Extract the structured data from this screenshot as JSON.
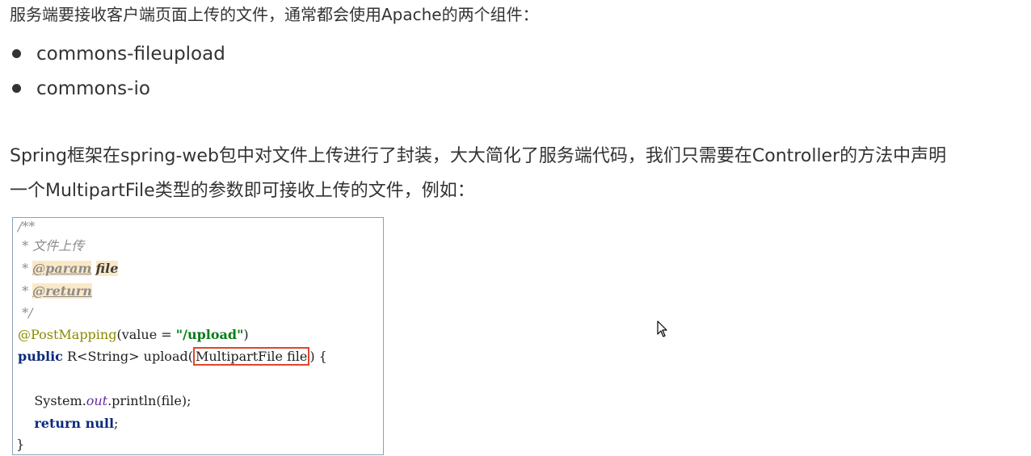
{
  "intro": "服务端要接收客户端页面上传的文件，通常都会使用Apache的两个组件：",
  "bullets": [
    "commons-fileupload",
    "commons-io"
  ],
  "paragraph": {
    "line1": "Spring框架在spring-web包中对文件上传进行了封装，大大简化了服务端代码，我们只需要在Controller的方法中声明",
    "line2": "一个MultipartFile类型的参数即可接收上传的文件，例如："
  },
  "code": {
    "c_open": "/**",
    "c_desc_star": " * ",
    "c_desc": "文件上传",
    "c_param_star": " * ",
    "c_param_tag": "@param",
    "c_param_name": "file",
    "c_return_star": " * ",
    "c_return_tag": "@return",
    "c_close": " */",
    "annotation": "@PostMapping",
    "annotation_open": "(value = ",
    "annotation_value": "\"/upload\"",
    "annotation_close": ")",
    "sig_public": "public",
    "sig_rest": " R<String> upload(",
    "sig_param": "MultipartFile file",
    "sig_end": ") {",
    "println_indent": "    System.",
    "println_field": "out",
    "println_rest": ".println(file);",
    "return_indent": "    ",
    "return_kw": "return null",
    "return_end": ";",
    "closing_brace": "}"
  },
  "icons": {
    "cursor": "mouse-pointer-icon",
    "bullet": "bullet-dot-icon"
  },
  "colors": {
    "highlight_box": "#e0452b",
    "annotation": "#8a8a00",
    "string": "#067d17",
    "keyword": "#0b2a7a",
    "comment": "#8c8c8c",
    "code_border": "#8aa2b8"
  }
}
